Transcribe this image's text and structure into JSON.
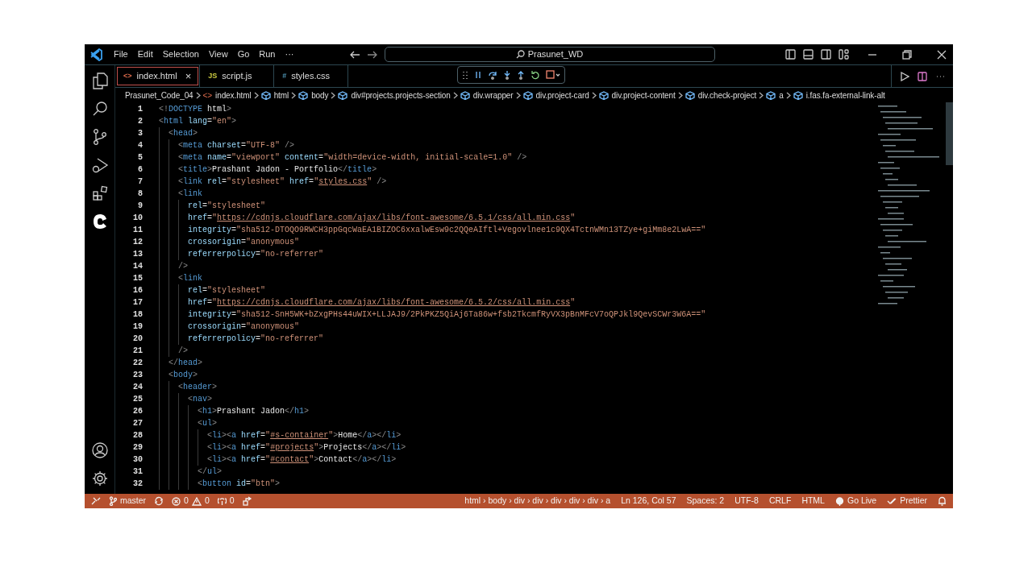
{
  "title_bar": {
    "menu": [
      "File",
      "Edit",
      "Selection",
      "View",
      "Go",
      "Run",
      "···"
    ],
    "search": "Prasunet_WD"
  },
  "tabs": [
    {
      "label": "index.html",
      "icon": "<>",
      "kind": "html",
      "selected": true,
      "close": "×"
    },
    {
      "label": "script.js",
      "icon": "JS",
      "kind": "js",
      "selected": false
    },
    {
      "label": "styles.css",
      "icon": "#",
      "kind": "css",
      "selected": false
    }
  ],
  "breadcrumbs": [
    {
      "label": "Prasunet_Code_04",
      "kind": "folder"
    },
    {
      "label": "index.html",
      "kind": "file",
      "icon": "<>"
    },
    {
      "label": "html",
      "kind": "element"
    },
    {
      "label": "body",
      "kind": "element"
    },
    {
      "label": "div#projects.projects-section",
      "kind": "element"
    },
    {
      "label": "div.wrapper",
      "kind": "element"
    },
    {
      "label": "div.project-card",
      "kind": "element"
    },
    {
      "label": "div.project-content",
      "kind": "element"
    },
    {
      "label": "div.check-project",
      "kind": "element"
    },
    {
      "label": "a",
      "kind": "element"
    },
    {
      "label": "i.fas.fa-external-link-alt",
      "kind": "element"
    }
  ],
  "editor": {
    "lines": [
      {
        "number": "1",
        "tokens": [
          {
            "kind": "punct",
            "text": "<!"
          },
          {
            "kind": "tag",
            "text": "DOCTYPE"
          },
          {
            "kind": "text",
            "text": " html"
          },
          {
            "kind": "punct",
            "text": ">"
          }
        ]
      },
      {
        "number": "2",
        "tokens": [
          {
            "kind": "punct",
            "text": "<"
          },
          {
            "kind": "tag",
            "text": "html"
          },
          {
            "kind": "attr",
            "text": " lang"
          },
          {
            "kind": "text",
            "text": "="
          },
          {
            "kind": "string",
            "text": "\"en\""
          },
          {
            "kind": "punct",
            "text": ">"
          }
        ]
      },
      {
        "number": "3",
        "tokens": [
          {
            "kind": "punct",
            "text": "  <"
          },
          {
            "kind": "tag",
            "text": "head"
          },
          {
            "kind": "punct",
            "text": ">"
          }
        ]
      },
      {
        "number": "4",
        "tokens": [
          {
            "kind": "punct",
            "text": "    <"
          },
          {
            "kind": "tag",
            "text": "meta"
          },
          {
            "kind": "attr",
            "text": " charset"
          },
          {
            "kind": "text",
            "text": "="
          },
          {
            "kind": "string",
            "text": "\"UTF-8\""
          },
          {
            "kind": "punct",
            "text": " />"
          }
        ]
      },
      {
        "number": "5",
        "tokens": [
          {
            "kind": "punct",
            "text": "    <"
          },
          {
            "kind": "tag",
            "text": "meta"
          },
          {
            "kind": "attr",
            "text": " name"
          },
          {
            "kind": "text",
            "text": "="
          },
          {
            "kind": "string",
            "text": "\"viewport\""
          },
          {
            "kind": "attr",
            "text": " content"
          },
          {
            "kind": "text",
            "text": "="
          },
          {
            "kind": "string",
            "text": "\"width=device-width, initial-scale=1.0\""
          },
          {
            "kind": "punct",
            "text": " />"
          }
        ]
      },
      {
        "number": "6",
        "tokens": [
          {
            "kind": "punct",
            "text": "    <"
          },
          {
            "kind": "tag",
            "text": "title"
          },
          {
            "kind": "punct",
            "text": ">"
          },
          {
            "kind": "text",
            "text": "Prashant Jadon - Portfolio"
          },
          {
            "kind": "punct",
            "text": "</"
          },
          {
            "kind": "tag",
            "text": "title"
          },
          {
            "kind": "punct",
            "text": ">"
          }
        ]
      },
      {
        "number": "7",
        "tokens": [
          {
            "kind": "punct",
            "text": "    <"
          },
          {
            "kind": "tag",
            "text": "link"
          },
          {
            "kind": "attr",
            "text": " rel"
          },
          {
            "kind": "text",
            "text": "="
          },
          {
            "kind": "string",
            "text": "\"stylesheet\""
          },
          {
            "kind": "attr",
            "text": " href"
          },
          {
            "kind": "text",
            "text": "="
          },
          {
            "kind": "string",
            "text": "\""
          },
          {
            "kind": "link",
            "text": "styles.css"
          },
          {
            "kind": "string",
            "text": "\""
          },
          {
            "kind": "punct",
            "text": " />"
          }
        ]
      },
      {
        "number": "8",
        "tokens": [
          {
            "kind": "punct",
            "text": "    <"
          },
          {
            "kind": "tag",
            "text": "link"
          }
        ]
      },
      {
        "number": "9",
        "tokens": [
          {
            "kind": "attr",
            "text": "      rel"
          },
          {
            "kind": "text",
            "text": "="
          },
          {
            "kind": "string",
            "text": "\"stylesheet\""
          }
        ]
      },
      {
        "number": "10",
        "tokens": [
          {
            "kind": "attr",
            "text": "      href"
          },
          {
            "kind": "text",
            "text": "="
          },
          {
            "kind": "string",
            "text": "\""
          },
          {
            "kind": "link",
            "text": "https://cdnjs.cloudflare.com/ajax/libs/font-awesome/6.5.1/css/all.min.css"
          },
          {
            "kind": "string",
            "text": "\""
          }
        ]
      },
      {
        "number": "11",
        "tokens": [
          {
            "kind": "attr",
            "text": "      integrity"
          },
          {
            "kind": "text",
            "text": "="
          },
          {
            "kind": "string",
            "text": "\"sha512-DTOQO9RWCH3ppGqcWaEA1BIZOC6xxalwEsw9c2QQeAIftl+Vegovlnee1c9QX4TctnWMn13TZye+giMm8e2LwA==\""
          }
        ]
      },
      {
        "number": "12",
        "tokens": [
          {
            "kind": "attr",
            "text": "      crossorigin"
          },
          {
            "kind": "text",
            "text": "="
          },
          {
            "kind": "string",
            "text": "\"anonymous\""
          }
        ]
      },
      {
        "number": "13",
        "tokens": [
          {
            "kind": "attr",
            "text": "      referrerpolicy"
          },
          {
            "kind": "text",
            "text": "="
          },
          {
            "kind": "string",
            "text": "\"no-referrer\""
          }
        ]
      },
      {
        "number": "14",
        "tokens": [
          {
            "kind": "punct",
            "text": "    />"
          }
        ]
      },
      {
        "number": "15",
        "tokens": [
          {
            "kind": "punct",
            "text": "    <"
          },
          {
            "kind": "tag",
            "text": "link"
          }
        ]
      },
      {
        "number": "16",
        "tokens": [
          {
            "kind": "attr",
            "text": "      rel"
          },
          {
            "kind": "text",
            "text": "="
          },
          {
            "kind": "string",
            "text": "\"stylesheet\""
          }
        ]
      },
      {
        "number": "17",
        "tokens": [
          {
            "kind": "attr",
            "text": "      href"
          },
          {
            "kind": "text",
            "text": "="
          },
          {
            "kind": "string",
            "text": "\""
          },
          {
            "kind": "link",
            "text": "https://cdnjs.cloudflare.com/ajax/libs/font-awesome/6.5.2/css/all.min.css"
          },
          {
            "kind": "string",
            "text": "\""
          }
        ]
      },
      {
        "number": "18",
        "tokens": [
          {
            "kind": "attr",
            "text": "      integrity"
          },
          {
            "kind": "text",
            "text": "="
          },
          {
            "kind": "string",
            "text": "\"sha512-SnH5WK+bZxgPHs44uWIX+LLJAJ9/2PkPKZ5QiAj6Ta86w+fsb2TkcmfRyVX3pBnMFcV7oQPJkl9QevSCWr3W6A==\""
          }
        ]
      },
      {
        "number": "19",
        "tokens": [
          {
            "kind": "attr",
            "text": "      crossorigin"
          },
          {
            "kind": "text",
            "text": "="
          },
          {
            "kind": "string",
            "text": "\"anonymous\""
          }
        ]
      },
      {
        "number": "20",
        "tokens": [
          {
            "kind": "attr",
            "text": "      referrerpolicy"
          },
          {
            "kind": "text",
            "text": "="
          },
          {
            "kind": "string",
            "text": "\"no-referrer\""
          }
        ]
      },
      {
        "number": "21",
        "tokens": [
          {
            "kind": "punct",
            "text": "    />"
          }
        ]
      },
      {
        "number": "22",
        "tokens": [
          {
            "kind": "punct",
            "text": "  </"
          },
          {
            "kind": "tag",
            "text": "head"
          },
          {
            "kind": "punct",
            "text": ">"
          }
        ]
      },
      {
        "number": "23",
        "tokens": [
          {
            "kind": "punct",
            "text": "  <"
          },
          {
            "kind": "tag",
            "text": "body"
          },
          {
            "kind": "punct",
            "text": ">"
          }
        ]
      },
      {
        "number": "24",
        "tokens": [
          {
            "kind": "punct",
            "text": "    <"
          },
          {
            "kind": "tag",
            "text": "header"
          },
          {
            "kind": "punct",
            "text": ">"
          }
        ]
      },
      {
        "number": "25",
        "tokens": [
          {
            "kind": "punct",
            "text": "      <"
          },
          {
            "kind": "tag",
            "text": "nav"
          },
          {
            "kind": "punct",
            "text": ">"
          }
        ]
      },
      {
        "number": "26",
        "tokens": [
          {
            "kind": "punct",
            "text": "        <"
          },
          {
            "kind": "tag",
            "text": "h1"
          },
          {
            "kind": "punct",
            "text": ">"
          },
          {
            "kind": "text",
            "text": "Prashant Jadon"
          },
          {
            "kind": "punct",
            "text": "</"
          },
          {
            "kind": "tag",
            "text": "h1"
          },
          {
            "kind": "punct",
            "text": ">"
          }
        ]
      },
      {
        "number": "27",
        "tokens": [
          {
            "kind": "punct",
            "text": "        <"
          },
          {
            "kind": "tag",
            "text": "ul"
          },
          {
            "kind": "punct",
            "text": ">"
          }
        ]
      },
      {
        "number": "28",
        "tokens": [
          {
            "kind": "punct",
            "text": "          <"
          },
          {
            "kind": "tag",
            "text": "li"
          },
          {
            "kind": "punct",
            "text": "><"
          },
          {
            "kind": "tag",
            "text": "a"
          },
          {
            "kind": "attr",
            "text": " href"
          },
          {
            "kind": "text",
            "text": "="
          },
          {
            "kind": "string",
            "text": "\""
          },
          {
            "kind": "link",
            "text": "#s-container"
          },
          {
            "kind": "string",
            "text": "\""
          },
          {
            "kind": "punct",
            "text": ">"
          },
          {
            "kind": "text",
            "text": "Home"
          },
          {
            "kind": "punct",
            "text": "</"
          },
          {
            "kind": "tag",
            "text": "a"
          },
          {
            "kind": "punct",
            "text": "></"
          },
          {
            "kind": "tag",
            "text": "li"
          },
          {
            "kind": "punct",
            "text": ">"
          }
        ]
      },
      {
        "number": "29",
        "tokens": [
          {
            "kind": "punct",
            "text": "          <"
          },
          {
            "kind": "tag",
            "text": "li"
          },
          {
            "kind": "punct",
            "text": "><"
          },
          {
            "kind": "tag",
            "text": "a"
          },
          {
            "kind": "attr",
            "text": " href"
          },
          {
            "kind": "text",
            "text": "="
          },
          {
            "kind": "string",
            "text": "\""
          },
          {
            "kind": "link",
            "text": "#projects"
          },
          {
            "kind": "string",
            "text": "\""
          },
          {
            "kind": "punct",
            "text": ">"
          },
          {
            "kind": "text",
            "text": "Projects"
          },
          {
            "kind": "punct",
            "text": "</"
          },
          {
            "kind": "tag",
            "text": "a"
          },
          {
            "kind": "punct",
            "text": "></"
          },
          {
            "kind": "tag",
            "text": "li"
          },
          {
            "kind": "punct",
            "text": ">"
          }
        ]
      },
      {
        "number": "30",
        "tokens": [
          {
            "kind": "punct",
            "text": "          <"
          },
          {
            "kind": "tag",
            "text": "li"
          },
          {
            "kind": "punct",
            "text": "><"
          },
          {
            "kind": "tag",
            "text": "a"
          },
          {
            "kind": "attr",
            "text": " href"
          },
          {
            "kind": "text",
            "text": "="
          },
          {
            "kind": "string",
            "text": "\""
          },
          {
            "kind": "link",
            "text": "#contact"
          },
          {
            "kind": "string",
            "text": "\""
          },
          {
            "kind": "punct",
            "text": ">"
          },
          {
            "kind": "text",
            "text": "Contact"
          },
          {
            "kind": "punct",
            "text": "</"
          },
          {
            "kind": "tag",
            "text": "a"
          },
          {
            "kind": "punct",
            "text": "></"
          },
          {
            "kind": "tag",
            "text": "li"
          },
          {
            "kind": "punct",
            "text": ">"
          }
        ]
      },
      {
        "number": "31",
        "tokens": [
          {
            "kind": "punct",
            "text": "        </"
          },
          {
            "kind": "tag",
            "text": "ul"
          },
          {
            "kind": "punct",
            "text": ">"
          }
        ]
      },
      {
        "number": "32",
        "tokens": [
          {
            "kind": "punct",
            "text": "        <"
          },
          {
            "kind": "tag",
            "text": "button"
          },
          {
            "kind": "attr",
            "text": " id"
          },
          {
            "kind": "text",
            "text": "="
          },
          {
            "kind": "string",
            "text": "\"btn\""
          },
          {
            "kind": "punct",
            "text": ">"
          }
        ]
      }
    ]
  },
  "status_bar": {
    "branch": "master",
    "errors": "0",
    "warnings": "0",
    "ports": "0",
    "right": [
      {
        "kind": "text",
        "text": "html › body › div › div › div › div › div › a"
      },
      {
        "kind": "text",
        "text": "Ln 126, Col 57"
      },
      {
        "kind": "text",
        "text": "Spaces: 2"
      },
      {
        "kind": "text",
        "text": "UTF-8"
      },
      {
        "kind": "text",
        "text": "CRLF"
      },
      {
        "kind": "text",
        "text": "HTML"
      },
      {
        "kind": "golive",
        "text": "Go Live"
      },
      {
        "kind": "prettier",
        "text": "Prettier"
      },
      {
        "kind": "bell"
      }
    ]
  }
}
